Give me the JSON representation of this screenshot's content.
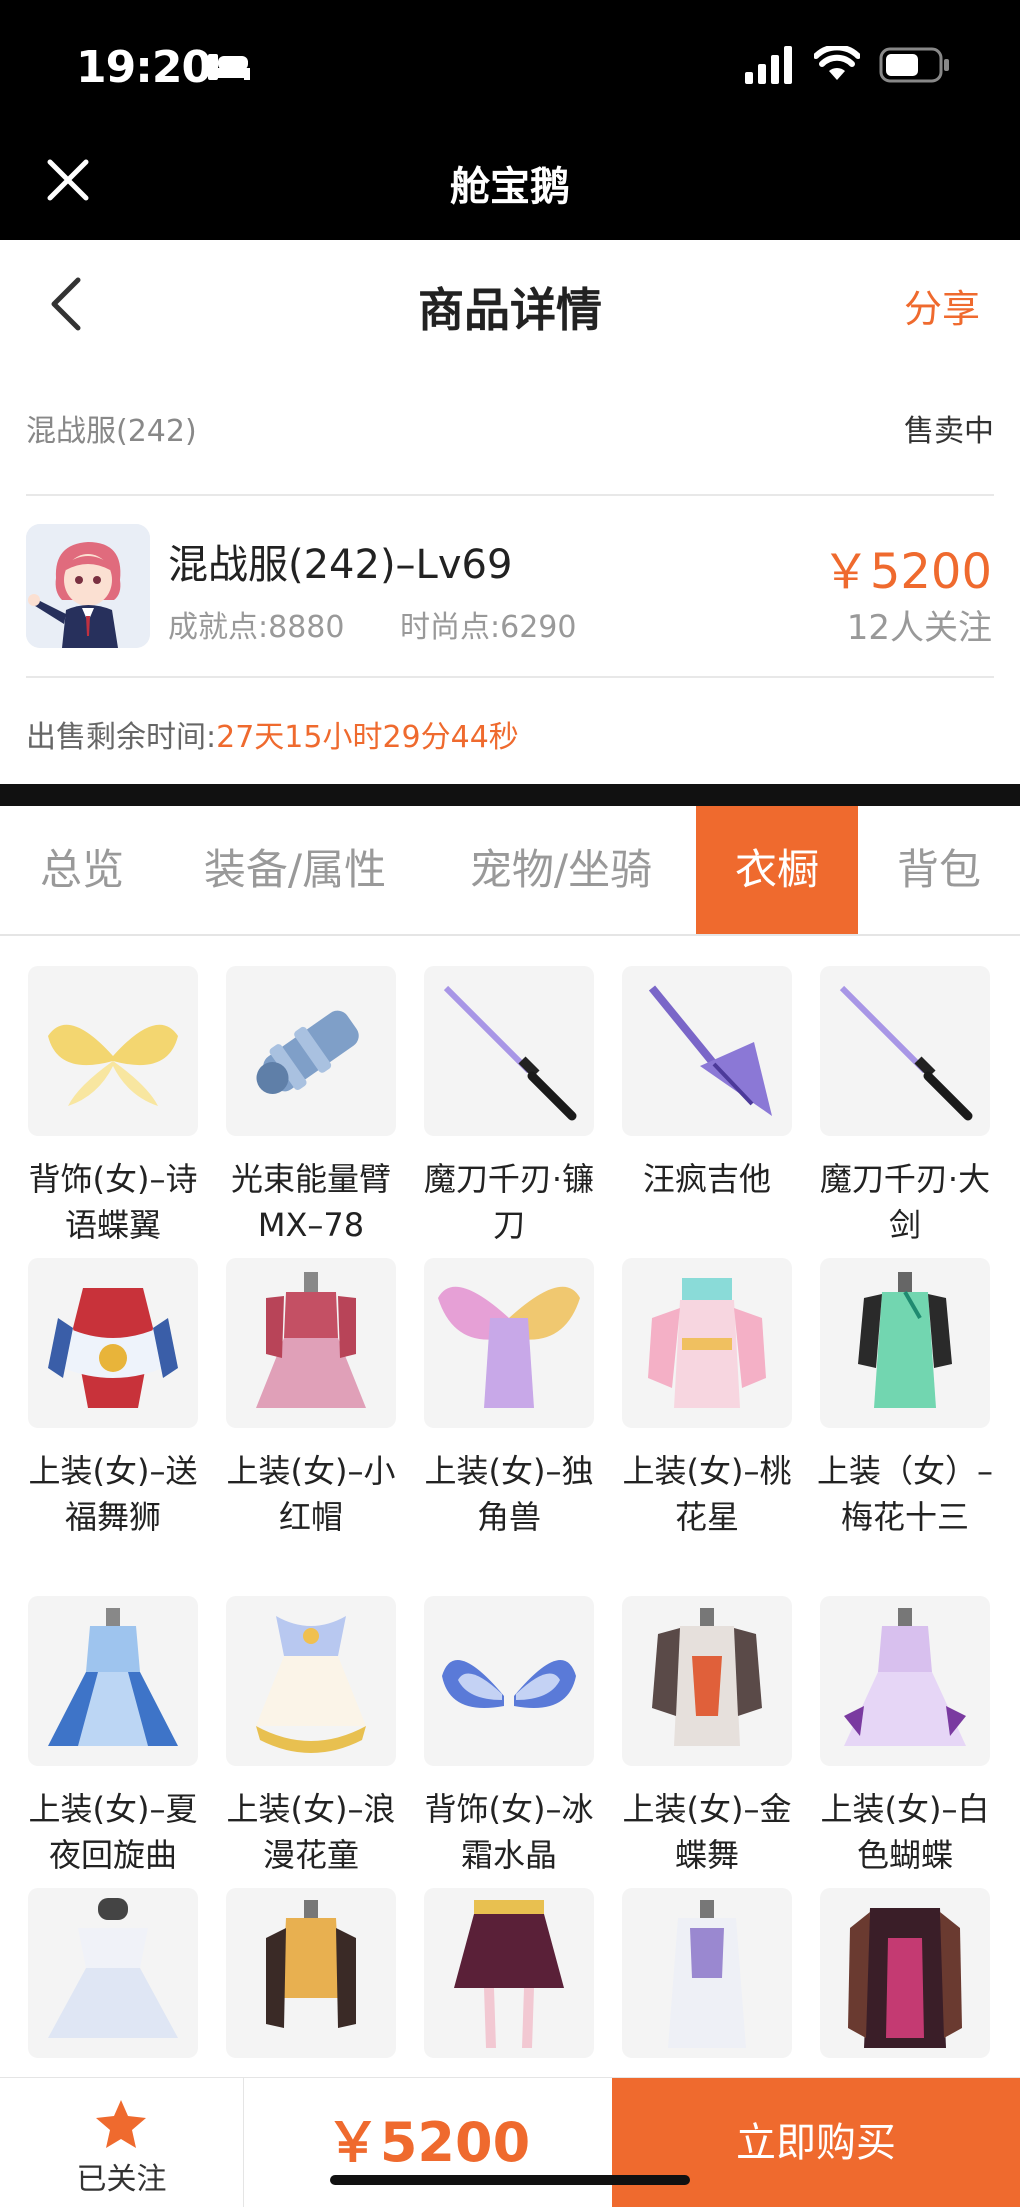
{
  "status_bar": {
    "time": "19:20"
  },
  "app_bar": {
    "title": "舱宝鹅"
  },
  "nav": {
    "title": "商品详情",
    "share": "分享"
  },
  "listing": {
    "server": "混战服(242)",
    "status": "售卖中",
    "item_name": "混战服(242)–Lv69",
    "achievement": "成就点:8880",
    "fashion": "时尚点:6290",
    "price": "￥5200",
    "watchers": "12人关注",
    "timer_label": "出售剩余时间:",
    "timer_value": "27天15小时29分44秒"
  },
  "tabs": [
    {
      "label": "总览",
      "active": false
    },
    {
      "label": "装备/属性",
      "active": false
    },
    {
      "label": "宠物/坐骑",
      "active": false
    },
    {
      "label": "衣橱",
      "active": true
    },
    {
      "label": "背包",
      "active": false
    }
  ],
  "wardrobe": [
    [
      {
        "label": "背饰(女)–诗语蝶翼",
        "icon": "butterfly-wings-icon"
      },
      {
        "label": "光束能量臂MX–78",
        "icon": "energy-arm-icon"
      },
      {
        "label": "魔刀千刃·镰刀",
        "icon": "katana-icon"
      },
      {
        "label": "汪疯吉他",
        "icon": "guitar-icon"
      },
      {
        "label": "魔刀千刃·大剑",
        "icon": "katana-icon"
      }
    ],
    [
      {
        "label": "上装(女)–送福舞狮",
        "icon": "lion-dress-icon"
      },
      {
        "label": "上装(女)–小红帽",
        "icon": "red-dress-icon"
      },
      {
        "label": "上装(女)–独角兽",
        "icon": "unicorn-outfit-icon"
      },
      {
        "label": "上装(女)–桃花星",
        "icon": "peach-dress-icon"
      },
      {
        "label": "上装（女）–梅花十三",
        "icon": "qipao-icon"
      }
    ],
    [
      {
        "label": "上装(女)–夏夜回旋曲",
        "icon": "blue-gown-icon"
      },
      {
        "label": "上装(女)–浪漫花童",
        "icon": "flower-dress-icon"
      },
      {
        "label": "背饰(女)–冰霜水晶",
        "icon": "ice-wings-icon"
      },
      {
        "label": "上装(女)–金蝶舞",
        "icon": "gold-outfit-icon"
      },
      {
        "label": "上装(女)–白色蝴蝶",
        "icon": "lilac-gown-icon"
      }
    ],
    [
      {
        "label": "",
        "icon": "white-gown-icon"
      },
      {
        "label": "",
        "icon": "gold-top-icon"
      },
      {
        "label": "",
        "icon": "pink-skirt-icon"
      },
      {
        "label": "",
        "icon": "white-coat-icon"
      },
      {
        "label": "",
        "icon": "dark-outfit-icon"
      }
    ]
  ],
  "bottom_bar": {
    "follow": "已关注",
    "price": "￥5200",
    "buy": "立即购买"
  },
  "colors": {
    "accent": "#ef6a2e",
    "dark": "#000000"
  }
}
